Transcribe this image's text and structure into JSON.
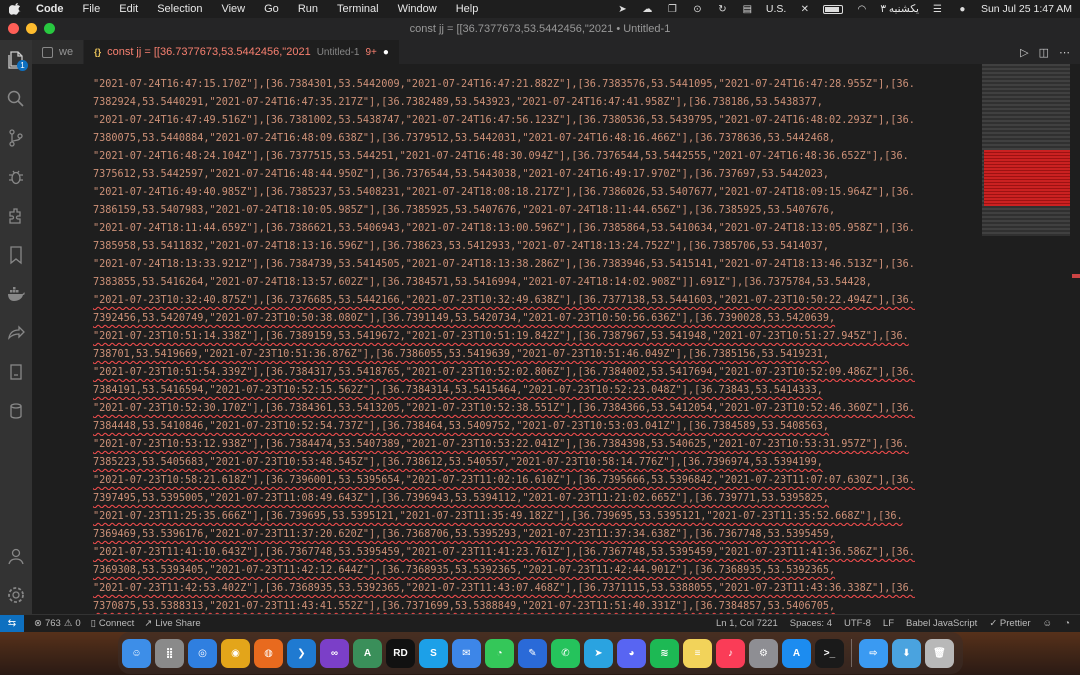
{
  "menubar": {
    "app": "Code",
    "items": [
      "File",
      "Edit",
      "Selection",
      "View",
      "Go",
      "Run",
      "Terminal",
      "Window",
      "Help"
    ],
    "input_source": "U.S.",
    "date_local": "یکشنبه ۳",
    "clock": "Sun Jul 25  1:47 AM"
  },
  "window": {
    "title": "const jj = [[36.7377673,53.5442456,\"2021 • Untitled-1"
  },
  "tabs": [
    {
      "label": "we",
      "active": false
    },
    {
      "label": "const jj = [[36.7377673,53.5442456,\"2021",
      "desc": "Untitled-1",
      "count": "9+",
      "dirty": "●",
      "active": true
    }
  ],
  "activity": {
    "explorer_badge": "1"
  },
  "editor": {
    "lines": [
      "\"2021-07-24T16:47:15.170Z\"],[36.7384301,53.5442009,\"2021-07-24T16:47:21.882Z\"],[36.7383576,53.5441095,\"2021-07-24T16:47:28.955Z\"],[36.",
      "7382924,53.5440291,\"2021-07-24T16:47:35.217Z\"],[36.7382489,53.543923,\"2021-07-24T16:47:41.958Z\"],[36.738186,53.5438377,",
      "\"2021-07-24T16:47:49.516Z\"],[36.7381002,53.5438747,\"2021-07-24T16:47:56.123Z\"],[36.7380536,53.5439795,\"2021-07-24T16:48:02.293Z\"],[36.",
      "7380075,53.5440884,\"2021-07-24T16:48:09.638Z\"],[36.7379512,53.5442031,\"2021-07-24T16:48:16.466Z\"],[36.7378636,53.5442468,",
      "\"2021-07-24T16:48:24.104Z\"],[36.7377515,53.544251,\"2021-07-24T16:48:30.094Z\"],[36.7376544,53.5442555,\"2021-07-24T16:48:36.652Z\"],[36.",
      "7375612,53.5442597,\"2021-07-24T16:48:44.950Z\"],[36.7376544,53.5443038,\"2021-07-24T16:49:17.970Z\"],[36.737697,53.5442023,",
      "\"2021-07-24T16:49:40.985Z\"],[36.7385237,53.5408231,\"2021-07-24T18:08:18.217Z\"],[36.7386026,53.5407677,\"2021-07-24T18:09:15.964Z\"],[36.",
      "7386159,53.5407983,\"2021-07-24T18:10:05.985Z\"],[36.7385925,53.5407676,\"2021-07-24T18:11:44.656Z\"],[36.7385925,53.5407676,",
      "\"2021-07-24T18:11:44.659Z\"],[36.7386621,53.5406943,\"2021-07-24T18:13:00.596Z\"],[36.7385864,53.5410634,\"2021-07-24T18:13:05.958Z\"],[36.",
      "7385958,53.5411832,\"2021-07-24T18:13:16.596Z\"],[36.738623,53.5412933,\"2021-07-24T18:13:24.752Z\"],[36.7385706,53.5414037,",
      "\"2021-07-24T18:13:33.921Z\"],[36.7384739,53.5414505,\"2021-07-24T18:13:38.286Z\"],[36.7383946,53.5415141,\"2021-07-24T18:13:46.513Z\"],[36.",
      "7383855,53.5416264,\"2021-07-24T18:13:57.602Z\"],[36.7384571,53.5416994,\"2021-07-24T18:14:02.908Z\"]].691Z\"],[36.7375784,53.54428,",
      "\"2021-07-23T10:32:40.875Z\"],[36.7376685,53.5442166,\"2021-07-23T10:32:49.638Z\"],[36.7377138,53.5441603,\"2021-07-23T10:50:22.494Z\"],[36.",
      "7392456,53.5420749,\"2021-07-23T10:50:38.080Z\"],[36.7391149,53.5420734,\"2021-07-23T10:50:56.636Z\"],[36.7390028,53.5420639,",
      "\"2021-07-23T10:51:14.338Z\"],[36.7389159,53.5419672,\"2021-07-23T10:51:19.842Z\"],[36.7387967,53.541948,\"2021-07-23T10:51:27.945Z\"],[36.",
      "738701,53.5419669,\"2021-07-23T10:51:36.876Z\"],[36.7386055,53.5419639,\"2021-07-23T10:51:46.049Z\"],[36.7385156,53.5419231,",
      "\"2021-07-23T10:51:54.339Z\"],[36.7384317,53.5418765,\"2021-07-23T10:52:02.806Z\"],[36.7384002,53.5417694,\"2021-07-23T10:52:09.486Z\"],[36.",
      "7384191,53.5416594,\"2021-07-23T10:52:15.562Z\"],[36.7384314,53.5415464,\"2021-07-23T10:52:23.048Z\"],[36.73843,53.5414333,",
      "\"2021-07-23T10:52:30.170Z\"],[36.7384361,53.5413205,\"2021-07-23T10:52:38.551Z\"],[36.7384366,53.5412054,\"2021-07-23T10:52:46.360Z\"],[36.",
      "7384448,53.5410846,\"2021-07-23T10:52:54.737Z\"],[36.738464,53.5409752,\"2021-07-23T10:53:03.041Z\"],[36.7384589,53.5408563,",
      "\"2021-07-23T10:53:12.938Z\"],[36.7384474,53.5407389,\"2021-07-23T10:53:22.041Z\"],[36.7384398,53.540625,\"2021-07-23T10:53:31.957Z\"],[36.",
      "7385223,53.5405683,\"2021-07-23T10:53:48.545Z\"],[36.738612,53.540557,\"2021-07-23T10:58:14.776Z\"],[36.7396974,53.5394199,",
      "\"2021-07-23T10:58:21.618Z\"],[36.7396001,53.5395654,\"2021-07-23T11:02:16.610Z\"],[36.7395666,53.5396842,\"2021-07-23T11:07:07.630Z\"],[36.",
      "7397495,53.5395005,\"2021-07-23T11:08:49.643Z\"],[36.7396943,53.5394112,\"2021-07-23T11:21:02.665Z\"],[36.739771,53.5395825,",
      "\"2021-07-23T11:25:35.666Z\"],[36.739695,53.5395121,\"2021-07-23T11:35:49.182Z\"],[36.739695,53.5395121,\"2021-07-23T11:35:52.668Z\"],[36.",
      "7369469,53.5396176,\"2021-07-23T11:37:20.620Z\"],[36.7368706,53.5395293,\"2021-07-23T11:37:34.638Z\"],[36.7367748,53.5395459,",
      "\"2021-07-23T11:41:10.643Z\"],[36.7367748,53.5395459,\"2021-07-23T11:41:23.761Z\"],[36.7367748,53.5395459,\"2021-07-23T11:41:36.586Z\"],[36.",
      "7369308,53.5393405,\"2021-07-23T11:42:12.644Z\"],[36.7368935,53.5392365,\"2021-07-23T11:42:44.901Z\"],[36.7368935,53.5392365,",
      "\"2021-07-23T11:42:53.402Z\"],[36.7368935,53.5392365,\"2021-07-23T11:43:07.468Z\"],[36.7371115,53.5388055,\"2021-07-23T11:43:36.338Z\"],[36.",
      "7370875,53.5388313,\"2021-07-23T11:43:41.552Z\"],[36.7371699,53.5388849,\"2021-07-23T11:51:40.331Z\"],[36.7384857,53.5406705,"
    ]
  },
  "statusbar": {
    "problems_errors": "763",
    "problems_warnings": "0",
    "connect": "Connect",
    "live_share": "Live Share",
    "position": "Ln 1, Col 7221",
    "spaces": "Spaces: 4",
    "encoding": "UTF-8",
    "eol": "LF",
    "language": "Babel JavaScript",
    "formatter": "✓ Prettier"
  },
  "dock": {
    "apps": [
      {
        "name": "Finder",
        "color": "#3d8ee8",
        "glyph": "☺"
      },
      {
        "name": "Launchpad",
        "color": "#8a8a8a",
        "glyph": "⣿"
      },
      {
        "name": "Safari",
        "color": "#2f7fe0",
        "glyph": "◎"
      },
      {
        "name": "Chrome",
        "color": "#e3a51a",
        "glyph": "◉"
      },
      {
        "name": "Firefox",
        "color": "#e86a1e",
        "glyph": "◍"
      },
      {
        "name": "VS Code",
        "color": "#1f7ad1",
        "glyph": "❯"
      },
      {
        "name": "Visual Studio",
        "color": "#7b3fc8",
        "glyph": "∞"
      },
      {
        "name": "Android Studio",
        "color": "#3a8f5a",
        "glyph": "A"
      },
      {
        "name": "Rider",
        "color": "#111111",
        "glyph": "RD"
      },
      {
        "name": "Skype",
        "color": "#1ca0e8",
        "glyph": "S"
      },
      {
        "name": "Mail",
        "color": "#3d86e8",
        "glyph": "✉"
      },
      {
        "name": "Messages",
        "color": "#34c759",
        "glyph": "◔"
      },
      {
        "name": "Editor",
        "color": "#2a6ad8",
        "glyph": "✎"
      },
      {
        "name": "WhatsApp",
        "color": "#25c35c",
        "glyph": "✆"
      },
      {
        "name": "Telegram",
        "color": "#2aa3e0",
        "glyph": "➤"
      },
      {
        "name": "Discord",
        "color": "#5865f2",
        "glyph": "◕"
      },
      {
        "name": "Spotify",
        "color": "#1db954",
        "glyph": "≋"
      },
      {
        "name": "Notes",
        "color": "#f2d35a",
        "glyph": "≡"
      },
      {
        "name": "Music",
        "color": "#fa3c57",
        "glyph": "♪"
      },
      {
        "name": "System Preferences",
        "color": "#8e8e93",
        "glyph": "⚙"
      },
      {
        "name": "App Store",
        "color": "#1c8cf0",
        "glyph": "A"
      },
      {
        "name": "Terminal",
        "color": "#1a1a1a",
        "glyph": ">_"
      },
      {
        "name": "Migration",
        "color": "#3a9af2",
        "glyph": "⇨"
      },
      {
        "name": "Downloads",
        "color": "#4aa3df",
        "glyph": "⬇"
      },
      {
        "name": "Trash",
        "color": "#b8b8b8",
        "glyph": "🗑"
      }
    ]
  }
}
